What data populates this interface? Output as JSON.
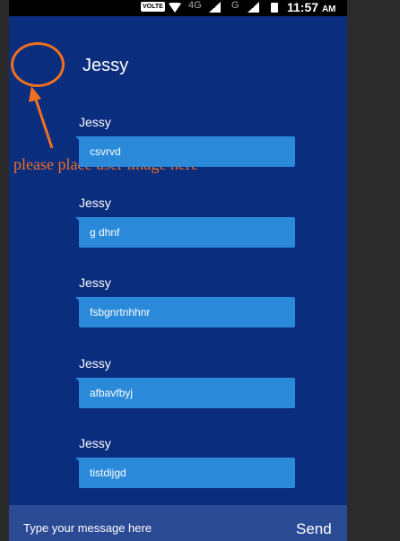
{
  "status_bar": {
    "volte": "VOLTE",
    "network_1": "4G",
    "network_2": "G",
    "sim_1": "R",
    "sim_2": "R",
    "time": "11:57",
    "ampm": "AM"
  },
  "toolbar": {
    "title": "Jessy"
  },
  "annotation": {
    "text": "please place user image here",
    "color": "#f07020"
  },
  "messages": [
    {
      "sender": "Jessy",
      "text": "csvrvd"
    },
    {
      "sender": "Jessy",
      "text": "g dhnf"
    },
    {
      "sender": "Jessy",
      "text": "fsbgnrtnhhnr"
    },
    {
      "sender": "Jessy",
      "text": "afbavfbyj"
    },
    {
      "sender": "Jessy",
      "text": "tistdijgd"
    }
  ],
  "input": {
    "value": "Type your message here",
    "send_label": "Send"
  },
  "colors": {
    "background": "#0b2d7e",
    "bubble": "#2a8ad9",
    "input_bar": "#2b4a94"
  }
}
